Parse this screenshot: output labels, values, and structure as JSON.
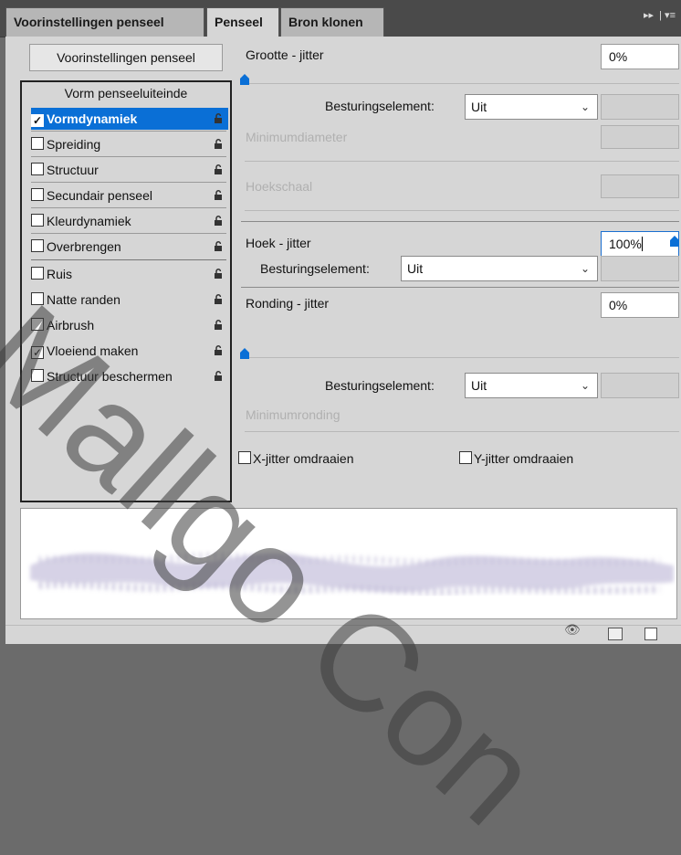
{
  "tabs": [
    {
      "label": "Voorinstellingen penseel",
      "active": false
    },
    {
      "label": "Penseel",
      "active": true
    },
    {
      "label": "Bron klonen",
      "active": false
    }
  ],
  "menu_icon": "panel-menu-icon",
  "presets_button": "Voorinstellingen penseel",
  "list": {
    "header": "Vorm penseeluiteinde",
    "items": [
      {
        "label": "Vormdynamiek",
        "checked": true,
        "selected": true
      },
      {
        "label": "Spreiding",
        "checked": false
      },
      {
        "label": "Structuur",
        "checked": false
      },
      {
        "label": "Secundair penseel",
        "checked": false
      },
      {
        "label": "Kleurdynamiek",
        "checked": false
      },
      {
        "label": "Overbrengen",
        "checked": false
      },
      {
        "label": "Ruis",
        "checked": false
      },
      {
        "label": "Natte randen",
        "checked": false
      },
      {
        "label": "Airbrush",
        "checked": false
      },
      {
        "label": "Vloeiend maken",
        "checked": true
      },
      {
        "label": "Structuur beschermen",
        "checked": false
      }
    ]
  },
  "size_jitter": {
    "label": "Grootte - jitter",
    "value": "0%",
    "slider": 0
  },
  "control1": {
    "label": "Besturingselement:",
    "value": "Uit"
  },
  "min_diameter": {
    "label": "Minimumdiameter"
  },
  "tilt_scale": {
    "label": "Hoekschaal"
  },
  "angle_jitter": {
    "label": "Hoek - jitter",
    "value": "100%",
    "slider": 1
  },
  "control2": {
    "label": "Besturingselement:",
    "value": "Uit"
  },
  "roundness_jitter": {
    "label": "Ronding - jitter",
    "value": "0%",
    "slider": 0
  },
  "control3": {
    "label": "Besturingselement:",
    "value": "Uit"
  },
  "min_roundness": {
    "label": "Minimumronding"
  },
  "flip_x": {
    "label": "X-jitter omdraaien",
    "checked": false
  },
  "flip_y": {
    "label": "Y-jitter omdraaien",
    "checked": false
  },
  "watermark": "Mallgo Con",
  "colors": {
    "accent": "#0a6fd6",
    "panel": "#d6d6d6"
  }
}
